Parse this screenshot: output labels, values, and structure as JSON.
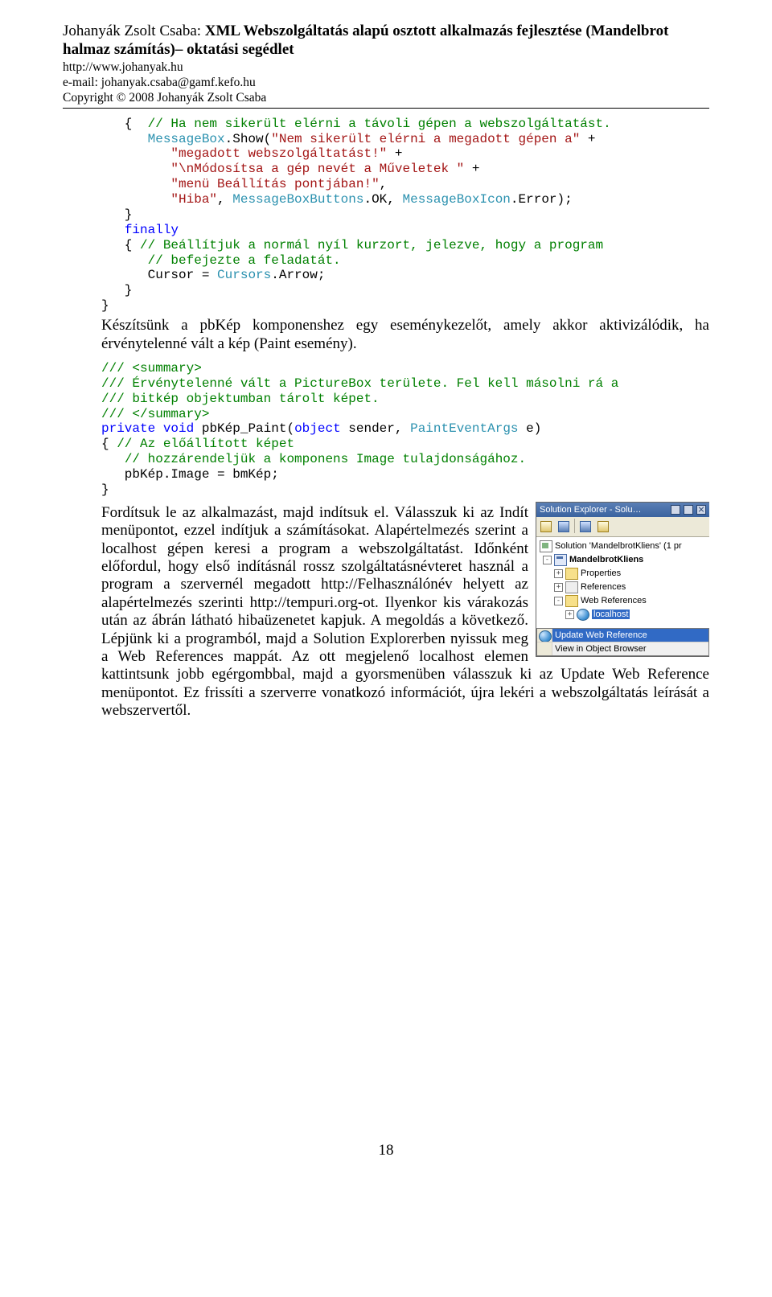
{
  "header": {
    "author": "Johanyák Zsolt Csaba: ",
    "title_bold": "XML Webszolgáltatás alapú osztott alkalmazás fejlesztése (Mandelbrot halmaz számítás)– oktatási segédlet",
    "url": "http://www.johanyak.hu",
    "email": "e-mail: johanyak.csaba@gamf.kefo.hu",
    "copyright": "Copyright © 2008 Johanyák Zsolt Csaba"
  },
  "code1": {
    "l1_brace": "   {  ",
    "l1_c": "// Ha nem sikerült elérni a távoli gépen a webszolgáltatást.",
    "l2a": "      ",
    "l2b": "MessageBox",
    "l2c": ".Show(",
    "l2d": "\"Nem sikerült elérni a megadott gépen a\"",
    "l2e": " + ",
    "l3a": "         ",
    "l3b": "\"megadott webszolgáltatást!\"",
    "l3c": " + ",
    "l4a": "         ",
    "l4b": "\"\\nMódosítsa a gép nevét a Műveletek \"",
    "l4c": " + ",
    "l5a": "         ",
    "l5b": "\"menü Beállítás pontjában!\"",
    "l5c": ",",
    "l6a": "         ",
    "l6b": "\"Hiba\"",
    "l6c": ", ",
    "l6d": "MessageBoxButtons",
    "l6e": ".OK, ",
    "l6f": "MessageBoxIcon",
    "l6g": ".Error);",
    "l7": "   }",
    "l8a": "   ",
    "l8b": "finally",
    "l9a": "   { ",
    "l9b": "// Beállítjuk a normál nyíl kurzort, jelezve, hogy a program",
    "l10a": "      ",
    "l10b": "// befejezte a feladatát.",
    "l11a": "      Cursor = ",
    "l11b": "Cursors",
    "l11c": ".Arrow;",
    "l12": "   }",
    "l13": "}"
  },
  "para1": "Készítsünk a pbKép komponenshez egy eseménykezelőt, amely akkor aktivizálódik, ha érvénytelenné vált a kép (Paint esemény).",
  "code2": {
    "l1": "/// <summary>",
    "l2": "/// Érvénytelenné vált a PictureBox területe. Fel kell másolni rá a",
    "l3": "/// bitkép objektumban tárolt képet.",
    "l4": "/// </summary>",
    "l5a": "private",
    "l5b": " ",
    "l5c": "void",
    "l5d": " pbKép_Paint(",
    "l5e": "object",
    "l5f": " sender, ",
    "l5g": "PaintEventArgs",
    "l5h": " e)",
    "l6a": "{ ",
    "l6b": "// Az előállított képet",
    "l7a": "   ",
    "l7b": "// hozzárendeljük a komponens Image tulajdonságához.",
    "l8": "   pbKép.Image = bmKép;",
    "l9": "}"
  },
  "para2": "Fordítsuk le az alkalmazást, majd indítsuk el. Válasszuk ki az Indít menüpontot, ezzel indítjuk a számításokat. Alapértelmezés szerint a localhost gépen keresi a program a webszolgáltatást. Időnként előfordul, hogy első indításnál rossz szolgáltatásnévteret használ a program a szervernél megadott http://Felhasználónév helyett az alapértelmezés szerinti http://tempuri.org-ot. Ilyenkor kis várakozás után az ábrán látható hibaüzenetet kapjuk. A megoldás a következő. Lépjünk ki a programból, majd a Solution Explorerben nyissuk meg a Web References mappát. Az ott megjelenő localhost elemen kattintsunk jobb egérgombbal, majd a gyorsmenüben válasszuk ki az Update Web Reference menüpontot. Ez frissíti a szerverre vonatkozó információt, újra lekéri a webszolgáltatás leírását a webszervertől.",
  "solution_explorer": {
    "title": "Solution Explorer - Solu…",
    "solution": "Solution 'MandelbrotKliens' (1 pr",
    "project": "MandelbrotKliens",
    "node_properties": "Properties",
    "node_refs": "References",
    "node_webrefs": "Web References",
    "node_localhost": "localhost",
    "ctx_update": "Update Web Reference",
    "ctx_view": "View in Object Browser"
  },
  "page_number": "18"
}
